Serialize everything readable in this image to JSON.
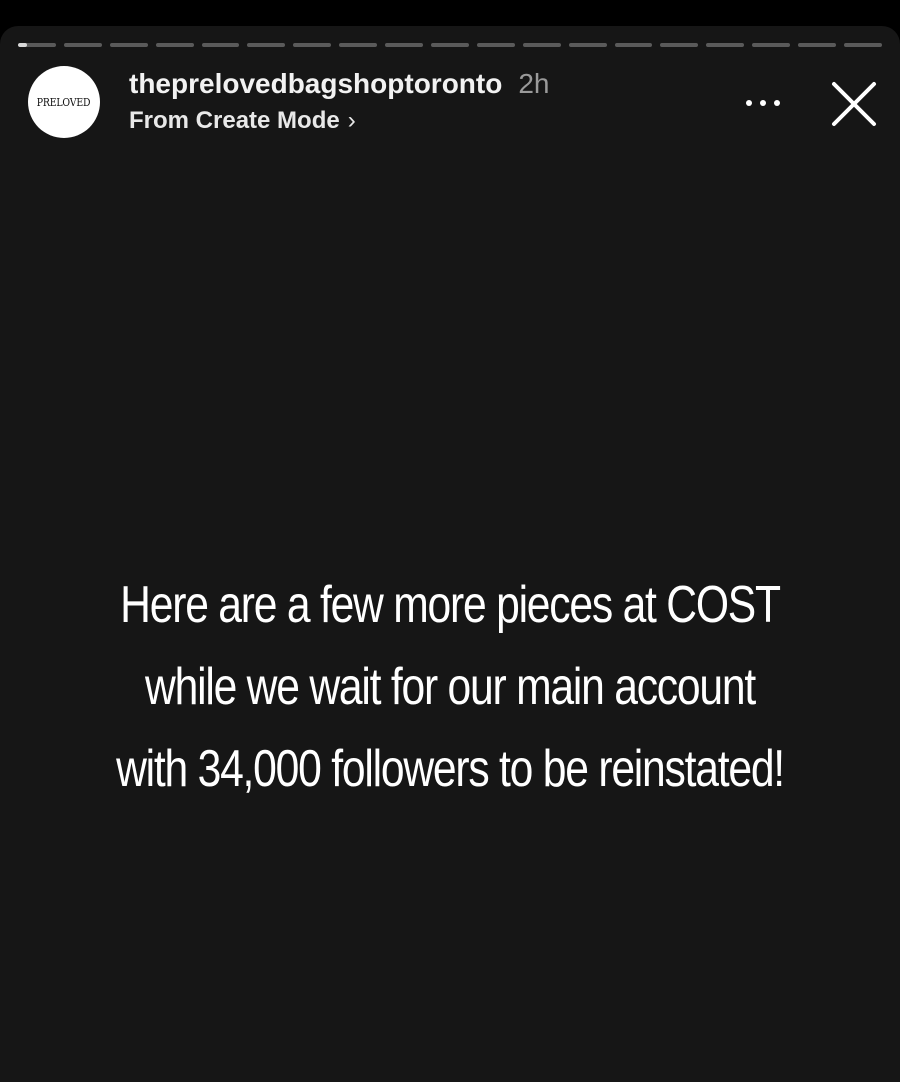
{
  "story": {
    "progress_segments": 19,
    "active_segment_index": 0,
    "active_segment_progress": 0.25,
    "text": "Here are a few more pieces at COST while we wait for our main account with 34,000 followers to be reinstated!"
  },
  "header": {
    "avatar_logo_text": "PRELOVED",
    "username": "theprelovedbagshoptoronto",
    "time_ago": "2h",
    "subtitle": "From Create Mode",
    "subtitle_chevron": "›",
    "more_icon": "more-horizontal-icon",
    "close_icon": "close-icon"
  },
  "colors": {
    "background": "#161616",
    "text": "#ffffff",
    "progress_track": "#5a5a5a",
    "progress_fill": "#d8d8d8",
    "time_text": "#9a9a9a"
  }
}
